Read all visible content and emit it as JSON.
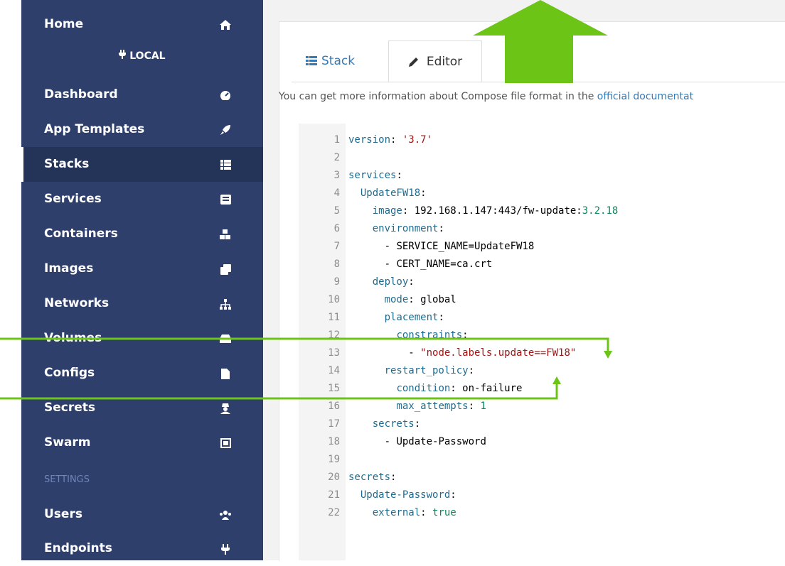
{
  "sidebar": {
    "home": "Home",
    "endpoint": "LOCAL",
    "items": [
      {
        "label": "Dashboard",
        "icon": "tachometer-icon"
      },
      {
        "label": "App Templates",
        "icon": "rocket-icon"
      },
      {
        "label": "Stacks",
        "icon": "th-list-icon"
      },
      {
        "label": "Services",
        "icon": "list-alt-icon"
      },
      {
        "label": "Containers",
        "icon": "cubes-icon"
      },
      {
        "label": "Images",
        "icon": "clone-icon"
      },
      {
        "label": "Networks",
        "icon": "sitemap-icon"
      },
      {
        "label": "Volumes",
        "icon": "hdd-icon"
      },
      {
        "label": "Configs",
        "icon": "file-code-icon"
      },
      {
        "label": "Secrets",
        "icon": "user-secret-icon"
      },
      {
        "label": "Swarm",
        "icon": "object-group-icon"
      }
    ],
    "settings_heading": "SETTINGS",
    "settings_items": [
      {
        "label": "Users",
        "icon": "users-icon"
      },
      {
        "label": "Endpoints",
        "icon": "plug-icon"
      }
    ]
  },
  "tabs": {
    "stack": "Stack",
    "editor": "Editor"
  },
  "info": {
    "text": "You can get more information about Compose file format in the ",
    "link": "official documentat"
  },
  "editor": {
    "line_numbers": [
      "1",
      "2",
      "3",
      "4",
      "5",
      "6",
      "7",
      "8",
      "9",
      "10",
      "11",
      "12",
      "13",
      "14",
      "15",
      "16",
      "17",
      "18",
      "19",
      "20",
      "21",
      "22"
    ],
    "lines": {
      "l1_key": "version",
      "l1_val": "'3.7'",
      "l3_key": "services",
      "l4_key": "UpdateFW18",
      "l5_key": "image",
      "l5_val": "192.168.1.147:443/fw-update:",
      "l5_ver": "3.2.18",
      "l6_key": "environment",
      "l7_val": "SERVICE_NAME=UpdateFW18",
      "l8_val": "CERT_NAME=ca.crt",
      "l9_key": "deploy",
      "l10_key": "mode",
      "l10_val": "global",
      "l11_key": "placement",
      "l12_key": "constraints",
      "l13_val": "\"node.labels.update==FW18\"",
      "l14_key": "restart_policy",
      "l15_key": "condition",
      "l15_val": "on-failure",
      "l16_key": "max_attempts",
      "l16_val": "1",
      "l17_key": "secrets",
      "l18_val": "Update-Password",
      "l20_key": "secrets",
      "l21_key": "Update-Password",
      "l22_key": "external",
      "l22_val": "true"
    }
  },
  "colors": {
    "sidebar": "#2e3f6c",
    "annotation": "#6cc417"
  }
}
